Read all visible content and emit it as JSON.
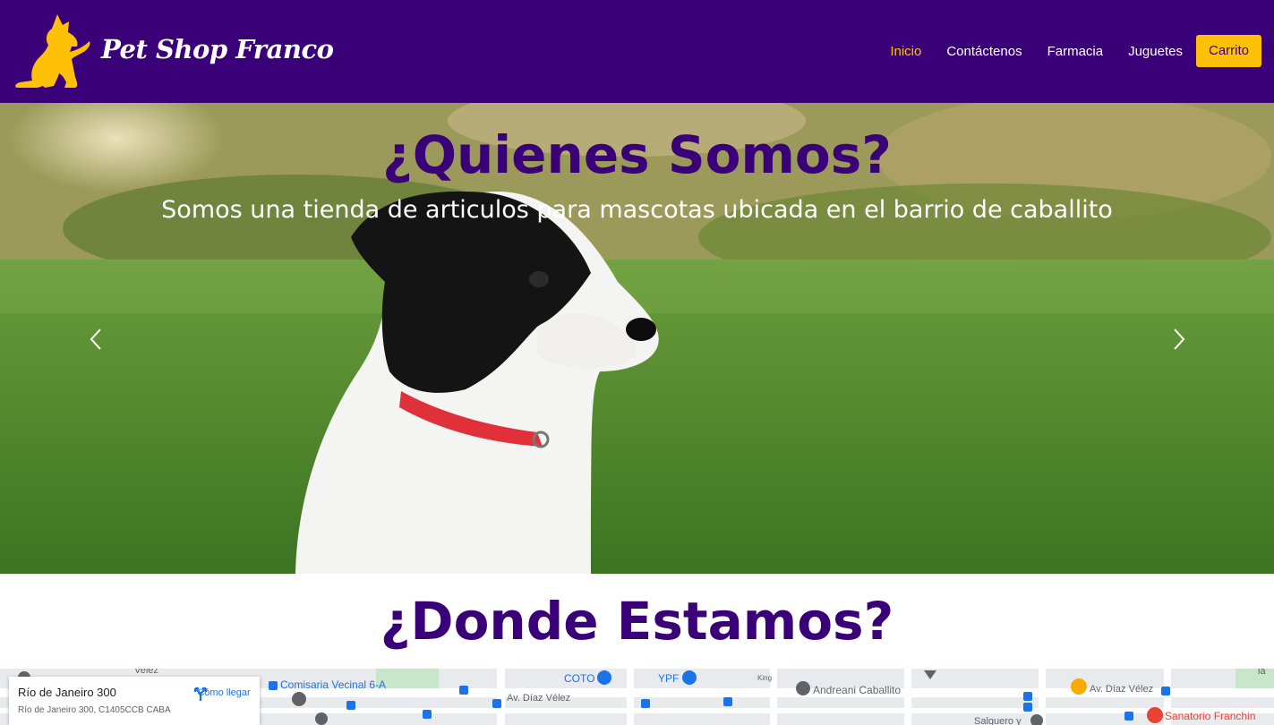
{
  "navbar": {
    "brand": "Pet Shop Franco",
    "logo_icon": "dog-logo-icon",
    "links": [
      {
        "label": "Inicio",
        "active": true
      },
      {
        "label": "Contáctenos",
        "active": false
      },
      {
        "label": "Farmacia",
        "active": false
      },
      {
        "label": "Juguetes",
        "active": false
      }
    ],
    "cart_label": "Carrito"
  },
  "hero": {
    "title": "¿Quienes Somos?",
    "subtitle": "Somos una tienda de articulos para mascotas ubicada en el barrio de caballito",
    "image": "puppy-on-grass-photo",
    "prev_icon": "chevron-left-icon",
    "next_icon": "chevron-right-icon"
  },
  "location": {
    "title": "¿Donde Estamos?"
  },
  "map": {
    "place_name": "Río de Janeiro 300",
    "place_address": "Río de Janeiro 300, C1405CCB CABA",
    "directions_label": "Cómo llegar",
    "labels": {
      "comisaria": "Comisaria Vecinal 6-A",
      "coto": "COTO",
      "ypf": "YPF",
      "diaz_velez_1": "Av. Díaz Vélez",
      "andreani": "Andreani Caballito",
      "diaz_velez_2": "Av. Díaz Vélez",
      "sanatorio": "Sanatorio Franchin",
      "salguero": "Salguero y",
      "velez": "Velez",
      "king": "King",
      "la": "la"
    }
  },
  "colors": {
    "primary": "#3a0077",
    "accent": "#ffc107",
    "white": "#ffffff"
  }
}
